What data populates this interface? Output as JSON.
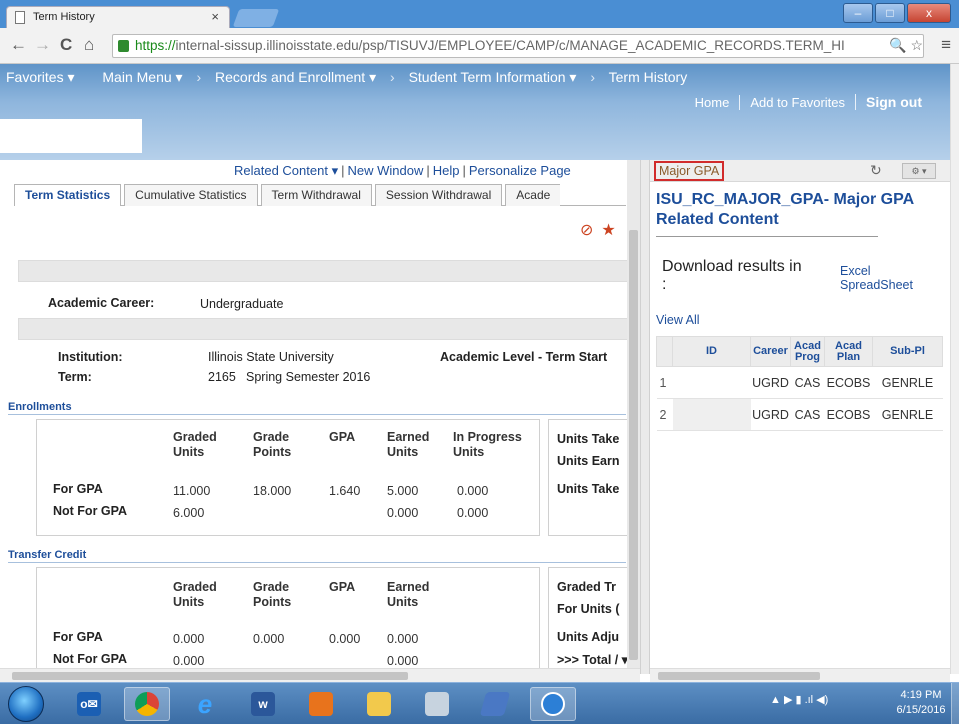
{
  "browser": {
    "tab_title": "Term History",
    "tab_close": "×",
    "url_https": "https://",
    "url_rest": "internal-sissup.illinoisstate.edu/psp/TISUVJ/EMPLOYEE/CAMP/c/MANAGE_ACADEMIC_RECORDS.TERM_HI",
    "back": "←",
    "forward": "→",
    "reload": "C",
    "home": "⌂",
    "zoom": "🔍",
    "star": "☆",
    "menu": "≡"
  },
  "window_buttons": {
    "minimize": "–",
    "maximize": "□",
    "close": "x"
  },
  "ps_nav": {
    "favorites": "Favorites ▾",
    "main_menu": "Main Menu ▾",
    "records": "Records and Enrollment ▾",
    "student_term": "Student Term Information ▾",
    "term_history": "Term History",
    "sep": "›"
  },
  "ps_links": {
    "home": "Home",
    "add_favorites": "Add to Favorites",
    "sign_out": "Sign out"
  },
  "related_bar": {
    "related_content": "Related Content ▾",
    "new_window": "New Window",
    "help": "Help",
    "personalize": "Personalize Page",
    "collapse": "»"
  },
  "tabs": {
    "term_statistics": "Term Statistics",
    "cumulative": "Cumulative Statistics",
    "term_withdrawal": "Term Withdrawal",
    "session_withdrawal": "Session Withdrawal",
    "academic": "Acade"
  },
  "action_icons": {
    "no": "⊘",
    "star": "★"
  },
  "career": {
    "label": "Academic Career:",
    "value": "Undergraduate"
  },
  "institution": {
    "label": "Institution:",
    "value": "Illinois State University",
    "term_label": "Term:",
    "term_code": "2165",
    "term_desc": "Spring Semester 2016",
    "level_label": "Academic Level - Term Start"
  },
  "enrollments": {
    "title": "Enrollments",
    "headers": {
      "graded_units": "Graded Units",
      "grade_points": "Grade Points",
      "gpa": "GPA",
      "earned_units": "Earned Units",
      "in_progress_units": "In Progress Units"
    },
    "for_gpa": {
      "label": "For GPA",
      "graded_units": "11.000",
      "grade_points": "18.000",
      "gpa": "1.640",
      "earned_units": "5.000",
      "in_progress": "0.000"
    },
    "not_for_gpa": {
      "label": "Not For GPA",
      "graded_units": "6.000",
      "earned_units": "0.000",
      "in_progress": "0.000"
    },
    "side": {
      "units_taken": "Units Take",
      "units_earned": "Units Earn",
      "units_taken2": "Units Take"
    }
  },
  "transfer": {
    "title": "Transfer Credit",
    "headers": {
      "graded_units": "Graded Units",
      "grade_points": "Grade Points",
      "gpa": "GPA",
      "earned_units": "Earned Units"
    },
    "for_gpa": {
      "label": "For GPA",
      "graded_units": "0.000",
      "grade_points": "0.000",
      "gpa": "0.000",
      "earned_units": "0.000"
    },
    "not_for_gpa": {
      "label": "Not For GPA",
      "graded_units": "0.000",
      "earned_units": "0.000"
    },
    "side": {
      "graded_transfer": "Graded Tr",
      "for_units": "For Units (",
      "units_adjust": "Units Adju",
      "total": ">>> Total / ▾"
    }
  },
  "related_panel": {
    "tab_title": "Major GPA",
    "refresh": "↻",
    "menu": "⚙ ▾",
    "heading": "ISU_RC_MAJOR_GPA- Major GPA Related Content",
    "download_text": "Download results in",
    "download_colon": ":",
    "excel_line1": "Excel",
    "excel_line2": "SpreadSheet",
    "view_all": "View All",
    "columns": [
      "ID",
      "Career",
      "Acad Prog",
      "Acad Plan",
      "Sub-Pl"
    ],
    "rows": [
      {
        "num": "1",
        "id": "",
        "career": "UGRD",
        "prog": "CAS",
        "plan": "ECOBS",
        "sub": "GENRLE"
      },
      {
        "num": "2",
        "id": "",
        "career": "UGRD",
        "prog": "CAS",
        "plan": "ECOBS",
        "sub": "GENRLE"
      }
    ]
  },
  "taskbar": {
    "outlook": "o✉",
    "ie": "e",
    "word": "w",
    "clock_time": "4:19 PM",
    "clock_date": "6/15/2016",
    "tray": "▲  ▶  ▮  .ıl  ◀)"
  }
}
